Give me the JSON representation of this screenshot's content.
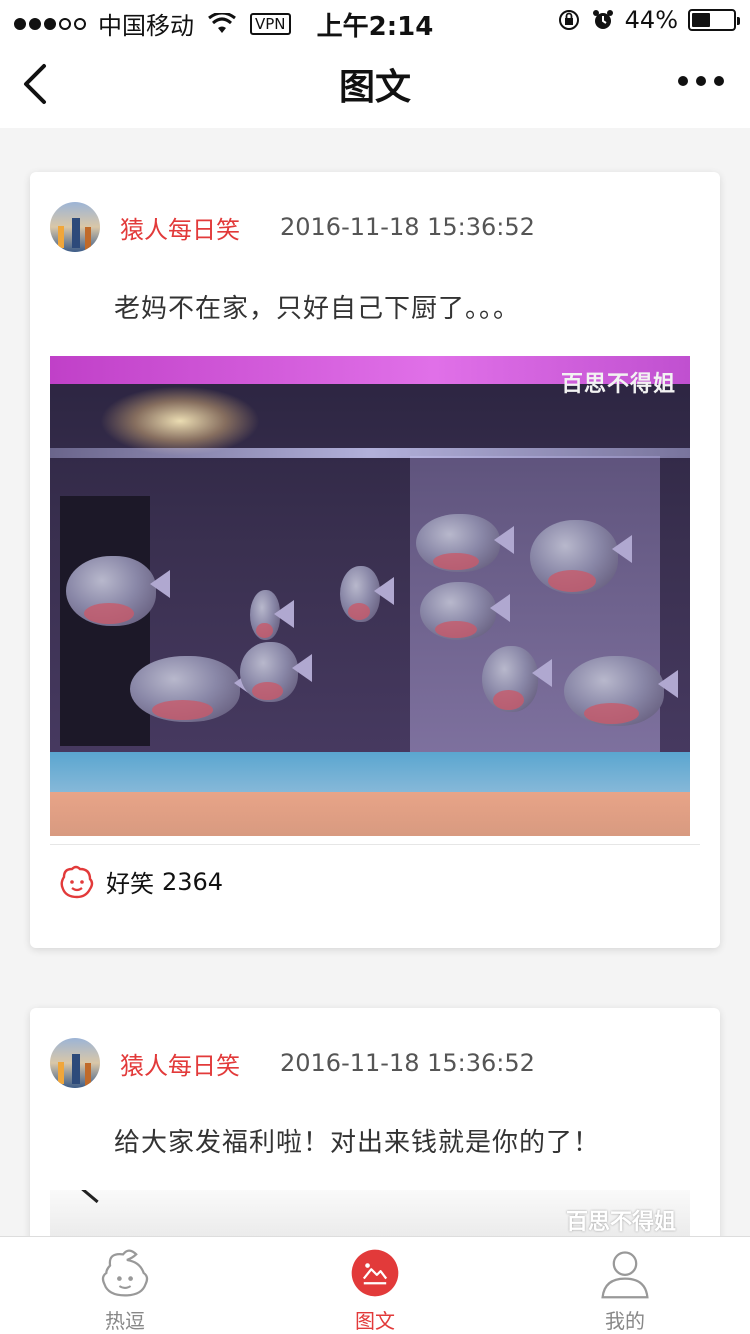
{
  "status_bar": {
    "carrier": "中国移动",
    "vpn": "VPN",
    "time": "上午2:14",
    "battery_text": "44%",
    "battery_level": 0.44,
    "signal_strength": 3,
    "signal_max": 5
  },
  "nav": {
    "title": "图文"
  },
  "posts": [
    {
      "author": "猿人每日笑",
      "time": "2016-11-18 15:36:52",
      "text": "老妈不在家，只好自己下厨了。。。",
      "image_watermark": "百思不得姐",
      "like_label": "好笑",
      "like_count": "2364"
    },
    {
      "author": "猿人每日笑",
      "time": "2016-11-18 15:36:52",
      "text": "给大家发福利啦！对出来钱就是你的了！",
      "image_watermark": "百思不得姐"
    }
  ],
  "tabs": [
    {
      "label": "热逗",
      "icon": "monkey-face-icon",
      "active": false
    },
    {
      "label": "图文",
      "icon": "picture-icon",
      "active": true
    },
    {
      "label": "我的",
      "icon": "person-icon",
      "active": false
    }
  ],
  "colors": {
    "accent": "#e23a3a",
    "background": "#f4f4f4",
    "tab_inactive": "#888888"
  }
}
